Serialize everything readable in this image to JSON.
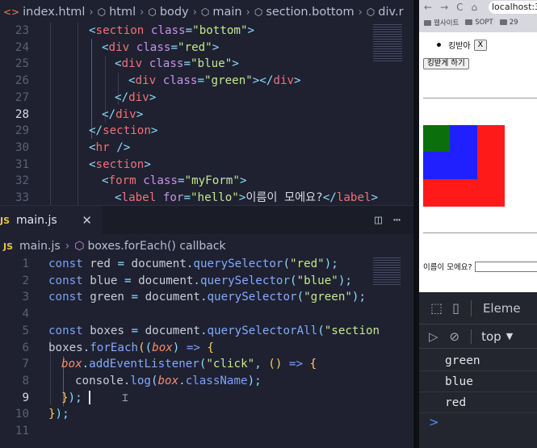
{
  "editor": {
    "breadcrumb_top": [
      "index.html",
      "html",
      "body",
      "main",
      "section.bottom",
      "div.r"
    ],
    "html_lines": [
      {
        "n": "23"
      },
      {
        "n": "24"
      },
      {
        "n": "25"
      },
      {
        "n": "26"
      },
      {
        "n": "27"
      },
      {
        "n": "28"
      },
      {
        "n": "29"
      },
      {
        "n": "30"
      },
      {
        "n": "31"
      },
      {
        "n": "32"
      },
      {
        "n": "33"
      }
    ],
    "html_strings": {
      "l23_attr": "class",
      "l23_val": "\"bottom\"",
      "l24_val": "\"red\"",
      "l25_val": "\"blue\"",
      "l26_val": "\"green\"",
      "l32_val": "\"myForm\"",
      "l33_attr": "for",
      "l33_val": "\"hello\"",
      "l33_text": "이름이 모에요?"
    },
    "tab": {
      "badge": "JS",
      "label": "main.js",
      "close": "✕"
    },
    "breadcrumb_js": [
      "main.js",
      "boxes.forEach() callback"
    ],
    "js_line_numbers": [
      "1",
      "2",
      "3",
      "4",
      "5",
      "6",
      "7",
      "8",
      "9",
      "10",
      "11"
    ],
    "js_strings": {
      "red": "\"red\"",
      "blue": "\"blue\"",
      "green": "\"green\"",
      "section": "\"section",
      "click": "\"click\"",
      "classname": "className"
    },
    "active_html_line": "28",
    "active_js_line": "9"
  },
  "browser": {
    "nav": [
      "←",
      "→",
      "C",
      "⌂"
    ],
    "url": "localhost:3",
    "bookmarks": [
      "웹사이트",
      "SOPT",
      "29"
    ],
    "list_item": "킹받아",
    "x_button": "X",
    "king_button": "킹받게 하기",
    "form_label": "이름이 모에요?",
    "box_colors": {
      "red": "#ff1a1a",
      "blue": "#2020ff",
      "green": "#0b700b"
    }
  },
  "devtools": {
    "tab_label": "Eleme",
    "context": "top",
    "console_lines": [
      "green",
      "blue",
      "red"
    ],
    "prompt": ">"
  }
}
